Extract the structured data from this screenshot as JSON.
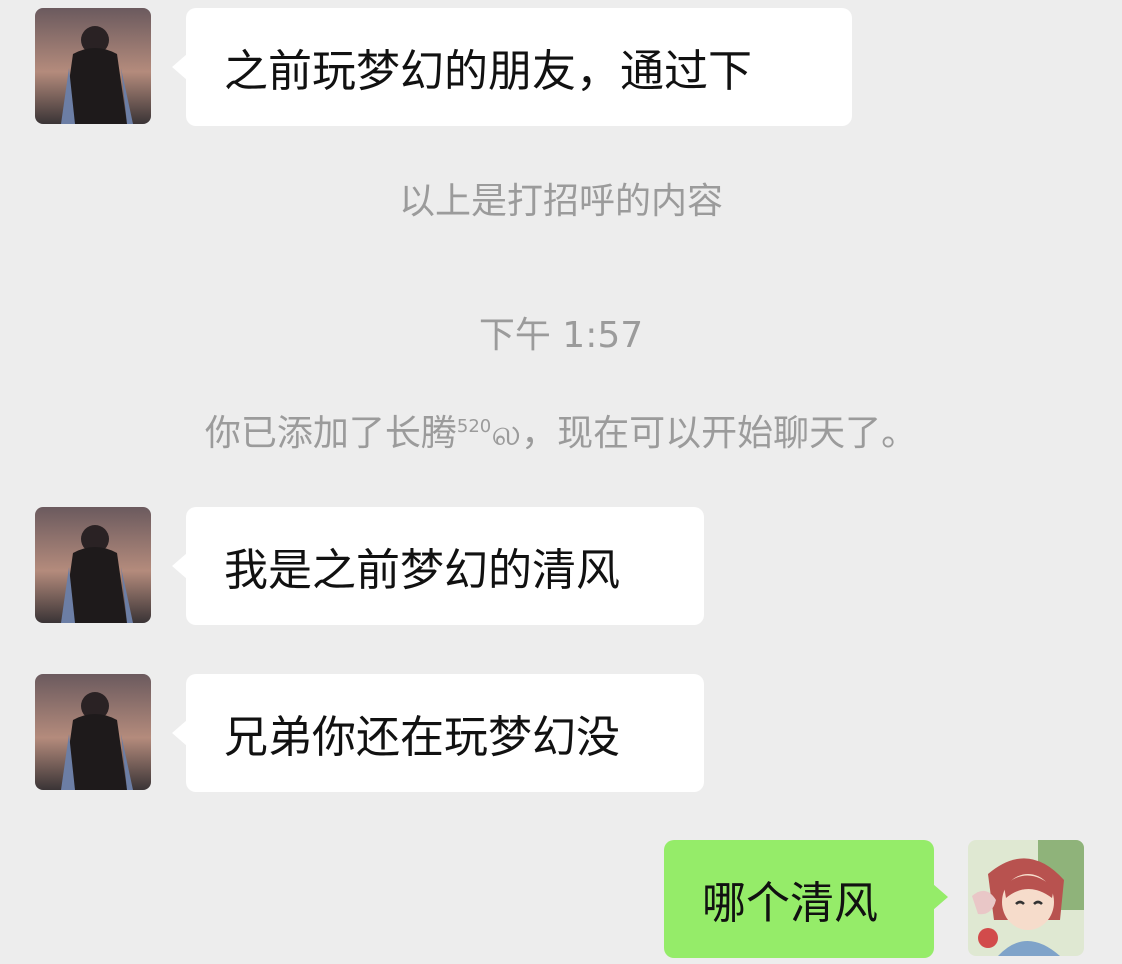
{
  "messages": [
    {
      "from": "contact",
      "text": "之前玩梦幻的朋友，通过下"
    },
    {
      "from": "contact",
      "text": "我是之前梦幻的清风"
    },
    {
      "from": "contact",
      "text": "兄弟你还在玩梦幻没"
    },
    {
      "from": "me",
      "text": "哪个清风"
    }
  ],
  "system": {
    "greeting_note": "以上是打招呼的内容",
    "timestamp": "下午 1:57",
    "added_notice_prefix": "你已添加了长腾",
    "added_notice_sup": "520",
    "added_notice_suffix": "ல，现在可以开始聊天了。"
  },
  "colors": {
    "background": "#ededed",
    "incoming_bubble": "#ffffff",
    "outgoing_bubble": "#95ec69",
    "system_text": "#9b9b9b"
  },
  "icons": {
    "contact_avatar": "silhouette-avatar",
    "my_avatar": "anime-avatar"
  }
}
